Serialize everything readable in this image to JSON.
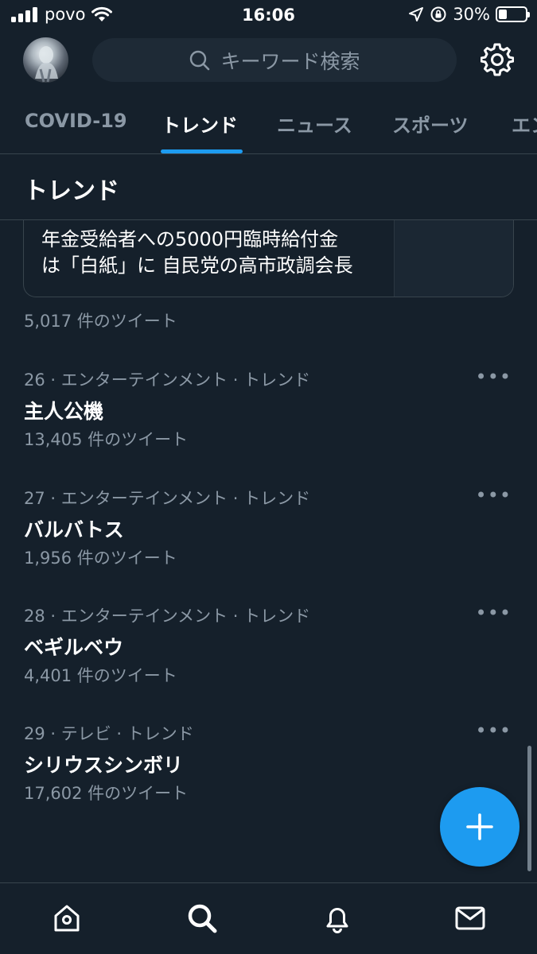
{
  "status_bar": {
    "carrier": "povo",
    "time": "16:06",
    "battery_percent": "30%",
    "battery_level": 0.3
  },
  "header": {
    "search_placeholder": "キーワード検索",
    "tabs": [
      {
        "label": "COVID-19",
        "active": false
      },
      {
        "label": "トレンド",
        "active": true
      },
      {
        "label": "ニュース",
        "active": false
      },
      {
        "label": "スポーツ",
        "active": false
      },
      {
        "label": "エン",
        "active": false
      }
    ]
  },
  "section": {
    "title": "トレンド"
  },
  "news_card": {
    "headline_line1": "年金受給者への5000円臨時給付金",
    "headline_line2": "は「白紙」に 自民党の高市政調会長",
    "tweet_count": "5,017 件のツイート"
  },
  "trends": [
    {
      "meta": "26 · エンターテインメント · トレンド",
      "name": "主人公機",
      "count": "13,405 件のツイート"
    },
    {
      "meta": "27 · エンターテインメント · トレンド",
      "name": "バルバトス",
      "count": "1,956 件のツイート"
    },
    {
      "meta": "28 · エンターテインメント · トレンド",
      "name": "ベギルベウ",
      "count": "4,401 件のツイート"
    },
    {
      "meta": "29 · テレビ · トレンド",
      "name": "シリウスシンボリ",
      "count": "17,602 件のツイート"
    }
  ],
  "colors": {
    "background": "#15202b",
    "accent": "#1d9bf0",
    "secondary_text": "#8b98a5",
    "divider": "#38444d"
  },
  "icons": {
    "nav": [
      "home-icon",
      "search-icon",
      "bell-icon",
      "mail-icon"
    ],
    "fab": "plus-icon",
    "settings": "gear-icon"
  }
}
